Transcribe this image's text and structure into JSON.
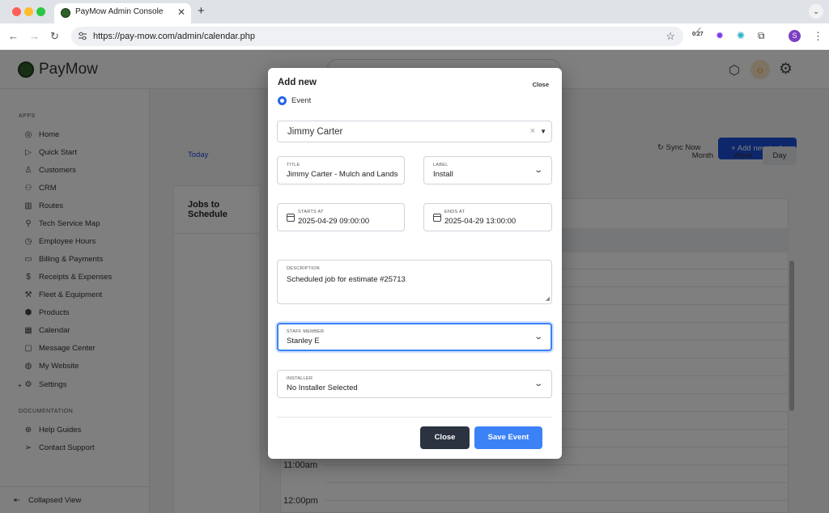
{
  "browser": {
    "tab_title": "PayMow Admin Console",
    "tab_close": "✕",
    "new_tab": "+",
    "url": "https://pay-mow.com/admin/calendar.php",
    "extension_badge": "0.27",
    "profile_initial": "S"
  },
  "app": {
    "logo_text": "PayMow",
    "sync_label": "Sync Now",
    "add_task_label": "+  Add new task",
    "today_label": "Today",
    "views": [
      "Month",
      "Week",
      "Day"
    ],
    "active_view": "Day",
    "jobs_title": "Jobs to Schedule",
    "times": [
      "11:00am",
      "12:00pm"
    ]
  },
  "sidebar": {
    "apps_heading": "APPS",
    "items": [
      {
        "label": "Home",
        "icon": "compass-icon"
      },
      {
        "label": "Quick Start",
        "icon": "play-circle-icon"
      },
      {
        "label": "Customers",
        "icon": "user-icon"
      },
      {
        "label": "CRM",
        "icon": "users-icon"
      },
      {
        "label": "Routes",
        "icon": "map-icon"
      },
      {
        "label": "Tech Service Map",
        "icon": "map-pin-icon"
      },
      {
        "label": "Employee Hours",
        "icon": "clock-icon"
      },
      {
        "label": "Billing & Payments",
        "icon": "credit-card-icon"
      },
      {
        "label": "Receipts & Expenses",
        "icon": "dollar-icon"
      },
      {
        "label": "Fleet & Equipment",
        "icon": "wrench-icon"
      },
      {
        "label": "Products",
        "icon": "box-icon"
      },
      {
        "label": "Calendar",
        "icon": "calendar-icon"
      },
      {
        "label": "Message Center",
        "icon": "message-icon"
      },
      {
        "label": "My Website",
        "icon": "globe-icon"
      },
      {
        "label": "Settings",
        "icon": "gear-icon"
      }
    ],
    "docs_heading": "DOCUMENTATION",
    "doc_items": [
      {
        "label": "Help Guides",
        "icon": "lifebuoy-icon"
      },
      {
        "label": "Contact Support",
        "icon": "send-icon"
      }
    ],
    "collapse_label": "Collapsed View"
  },
  "modal": {
    "title": "Add new",
    "close_link": "Close",
    "type_option": "Event",
    "customer": "Jimmy Carter",
    "title_field": {
      "label": "TITLE",
      "value": "Jimmy Carter - Mulch and Landscaping"
    },
    "label_field": {
      "label": "LABEL",
      "value": "Install"
    },
    "starts_at": {
      "label": "STARTS AT",
      "value": "2025-04-29 09:00:00"
    },
    "ends_at": {
      "label": "ENDS AT",
      "value": "2025-04-29 13:00:00"
    },
    "description": {
      "label": "DESCRIPTION",
      "value": "Scheduled job for estimate #25713"
    },
    "staff_member": {
      "label": "STAFF MEMBER",
      "value": "Stanley E"
    },
    "installer": {
      "label": "INSTALLER",
      "value": "No Installer Selected"
    },
    "close_button": "Close",
    "save_button": "Save Event"
  },
  "colors": {
    "primary": "#3b82f6",
    "dark_button": "#2b3340",
    "brand_green": "#2f5f2a"
  }
}
